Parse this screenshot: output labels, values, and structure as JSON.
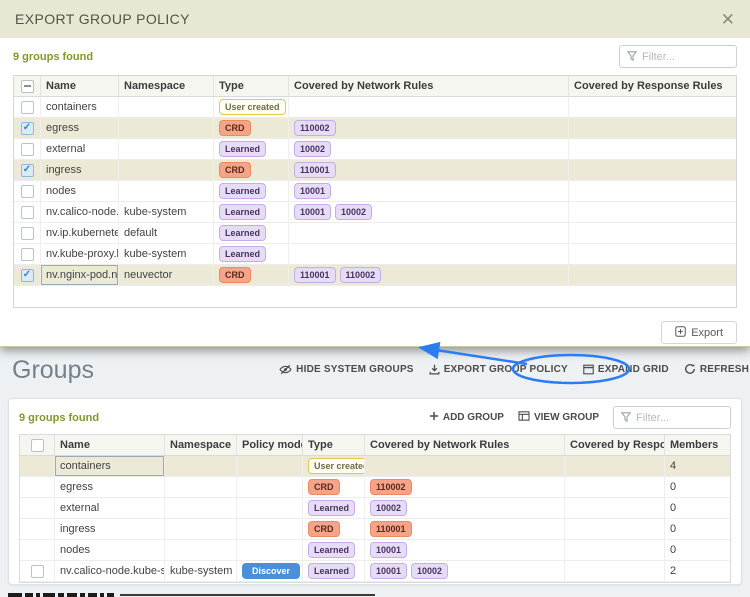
{
  "modal": {
    "title": "EXPORT GROUP POLICY",
    "close_label": "✕",
    "found_text": "9 groups found",
    "filter_placeholder": "Filter...",
    "columns": [
      "Name",
      "Namespace",
      "Type",
      "Covered by Network Rules",
      "Covered by Response Rules"
    ],
    "rows": [
      {
        "name": "containers",
        "namespace": "",
        "type": "User created",
        "type_style": "user",
        "network_rules": [],
        "response_rules": [],
        "checked": false,
        "selected": false,
        "focus": false
      },
      {
        "name": "egress",
        "namespace": "",
        "type": "CRD",
        "type_style": "crd",
        "network_rules": [
          "110002"
        ],
        "response_rules": [],
        "checked": true,
        "selected": true,
        "focus": false
      },
      {
        "name": "external",
        "namespace": "",
        "type": "Learned",
        "type_style": "learned",
        "network_rules": [
          "10002"
        ],
        "response_rules": [],
        "checked": false,
        "selected": false,
        "focus": false
      },
      {
        "name": "ingress",
        "namespace": "",
        "type": "CRD",
        "type_style": "crd",
        "network_rules": [
          "110001"
        ],
        "response_rules": [],
        "checked": true,
        "selected": true,
        "focus": false
      },
      {
        "name": "nodes",
        "namespace": "",
        "type": "Learned",
        "type_style": "learned",
        "network_rules": [
          "10001"
        ],
        "response_rules": [],
        "checked": false,
        "selected": false,
        "focus": false
      },
      {
        "name": "nv.calico-node.kub",
        "namespace": "kube-system",
        "type": "Learned",
        "type_style": "learned",
        "network_rules": [
          "10001",
          "10002"
        ],
        "response_rules": [],
        "checked": false,
        "selected": false,
        "focus": false
      },
      {
        "name": "nv.ip.kubernetes.d",
        "namespace": "default",
        "type": "Learned",
        "type_style": "learned",
        "network_rules": [],
        "response_rules": [],
        "checked": false,
        "selected": false,
        "focus": false
      },
      {
        "name": "nv.kube-proxy.kub",
        "namespace": "kube-system",
        "type": "Learned",
        "type_style": "learned",
        "network_rules": [],
        "response_rules": [],
        "checked": false,
        "selected": false,
        "focus": false
      },
      {
        "name": "nv.nginx-pod.neuv",
        "namespace": "neuvector",
        "type": "CRD",
        "type_style": "crd",
        "network_rules": [
          "110001",
          "110002"
        ],
        "response_rules": [],
        "checked": true,
        "selected": true,
        "focus": true
      }
    ],
    "export_button": "Export"
  },
  "page": {
    "title": "Groups",
    "toolbar": [
      {
        "label": "HIDE SYSTEM GROUPS",
        "icon": "eye-off-icon"
      },
      {
        "label": "EXPORT GROUP POLICY",
        "icon": "download-icon"
      },
      {
        "label": "EXPAND GRID",
        "icon": "expand-icon"
      },
      {
        "label": "REFRESH",
        "icon": "refresh-icon"
      }
    ],
    "found_text": "9 groups found",
    "actions": [
      {
        "label": "ADD GROUP",
        "icon": "plus-icon"
      },
      {
        "label": "VIEW GROUP",
        "icon": "grid-icon"
      }
    ],
    "filter_placeholder": "Filter...",
    "columns": [
      "Name",
      "Namespace",
      "Policy mode",
      "Type",
      "Covered by Network Rules",
      "Covered by Response R...",
      "Members"
    ],
    "rows": [
      {
        "name": "containers",
        "namespace": "",
        "policy_mode": "",
        "type": "User created",
        "type_style": "user",
        "network_rules": [],
        "rule_style": "purple",
        "members": "4",
        "selected": true,
        "has_checkbox": false,
        "focus": true
      },
      {
        "name": "egress",
        "namespace": "",
        "policy_mode": "",
        "type": "CRD",
        "type_style": "crd",
        "network_rules": [
          "110002"
        ],
        "rule_style": "orange",
        "members": "0",
        "selected": false,
        "has_checkbox": false,
        "focus": false
      },
      {
        "name": "external",
        "namespace": "",
        "policy_mode": "",
        "type": "Learned",
        "type_style": "learned",
        "network_rules": [
          "10002"
        ],
        "rule_style": "purple",
        "members": "0",
        "selected": false,
        "has_checkbox": false,
        "focus": false
      },
      {
        "name": "ingress",
        "namespace": "",
        "policy_mode": "",
        "type": "CRD",
        "type_style": "crd",
        "network_rules": [
          "110001"
        ],
        "rule_style": "orange",
        "members": "0",
        "selected": false,
        "has_checkbox": false,
        "focus": false
      },
      {
        "name": "nodes",
        "namespace": "",
        "policy_mode": "",
        "type": "Learned",
        "type_style": "learned",
        "network_rules": [
          "10001"
        ],
        "rule_style": "purple",
        "members": "0",
        "selected": false,
        "has_checkbox": false,
        "focus": false
      },
      {
        "name": "nv.calico-node.kube-sys",
        "namespace": "kube-system",
        "policy_mode": "Discover",
        "type": "Learned",
        "type_style": "learned",
        "network_rules": [
          "10001",
          "10002"
        ],
        "rule_style": "purple",
        "members": "2",
        "selected": false,
        "has_checkbox": true,
        "focus": false
      }
    ]
  },
  "annotation": {
    "color": "#2b7bf3"
  },
  "colors": {
    "modal_header_bg": "#e8e7d3",
    "found_text": "#7f9a28",
    "selected_row": "#ecead7",
    "badge_crd_bg": "#f4a488",
    "badge_learned_bg": "#e7dcf6",
    "badge_user_border": "#ddca4e",
    "discover_bg": "#4a90d9",
    "annotation_blue": "#2b7bf3"
  }
}
